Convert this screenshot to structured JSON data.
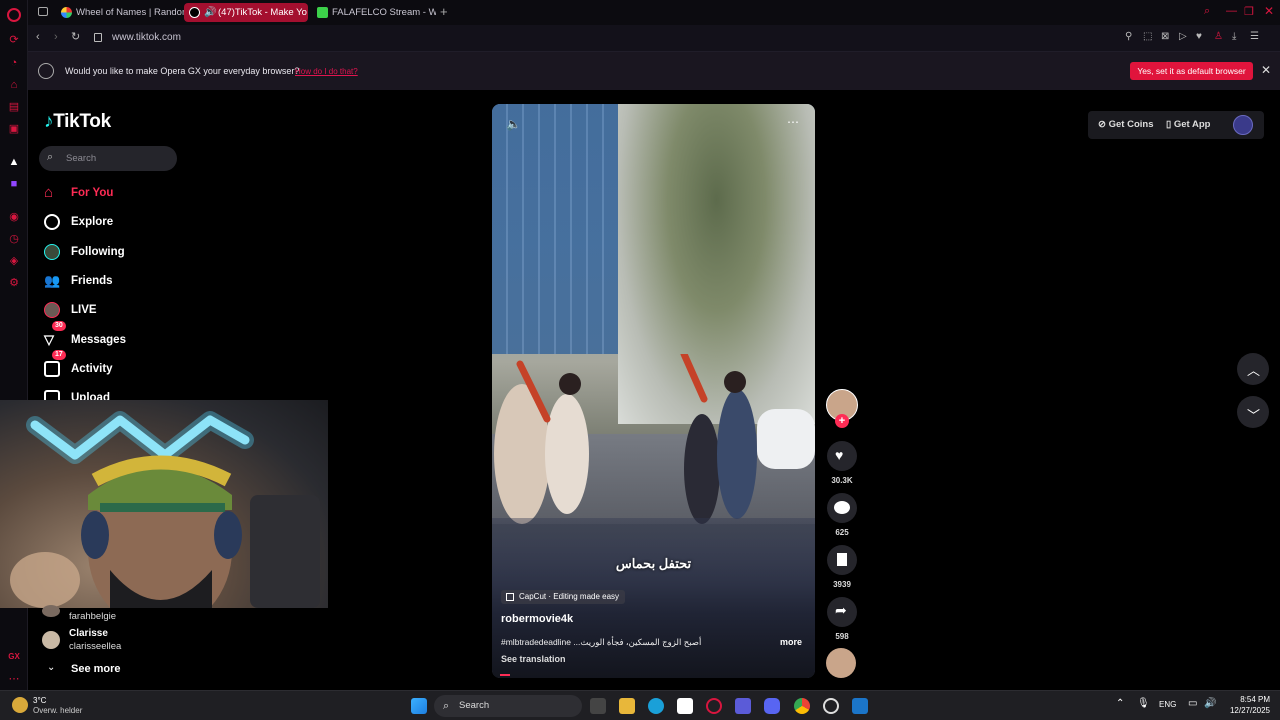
{
  "browser": {
    "tabs": [
      {
        "label": "Wheel of Names | Random"
      },
      {
        "label": "(47)TikTok - Make Yo"
      },
      {
        "label": "FALAFELCO Stream - Wa"
      }
    ],
    "url": "www.tiktok.com",
    "notification": {
      "text": "Would you like to make Opera GX your everyday browser?",
      "link": "How do I do that?",
      "button": "Yes, set it as default browser"
    }
  },
  "tiktok": {
    "logo": "TikTok",
    "search_placeholder": "Search",
    "nav": [
      {
        "label": "For You",
        "icon": "home-icon",
        "active": true
      },
      {
        "label": "Explore",
        "icon": "compass-icon"
      },
      {
        "label": "Following",
        "icon": "following-icon"
      },
      {
        "label": "Friends",
        "icon": "friends-icon"
      },
      {
        "label": "LIVE",
        "icon": "live-icon"
      },
      {
        "label": "Messages",
        "icon": "messages-icon",
        "badge": "30"
      },
      {
        "label": "Activity",
        "icon": "activity-icon",
        "badge": "17"
      },
      {
        "label": "Upload",
        "icon": "upload-icon"
      }
    ],
    "following_accounts": [
      {
        "name": "farahbelgie"
      },
      {
        "name": "Clarisse",
        "handle": "clarisseellea"
      }
    ],
    "see_more": "See more",
    "top_right": {
      "get_coins": "Get Coins",
      "get_app": "Get App"
    },
    "video": {
      "subtitle": "تحتفل بحماس",
      "capcut": "CapCut · Editing made easy",
      "author": "robermovie4k",
      "description": "#mlbtradedeadline ...أصبح الزوج المسكين، فجأة الوريث",
      "more": "more",
      "see_translation": "See translation"
    },
    "actions": {
      "likes": "30.3K",
      "comments": "625",
      "saves": "3939",
      "shares": "598"
    }
  },
  "taskbar": {
    "weather_temp": "3°C",
    "weather_desc": "Overw. helder",
    "search": "Search",
    "lang": "ENG",
    "time": "8:54 PM",
    "date": "12/27/2025"
  },
  "colors": {
    "accent": "#fe2c55",
    "opera_red": "#e0143c"
  }
}
